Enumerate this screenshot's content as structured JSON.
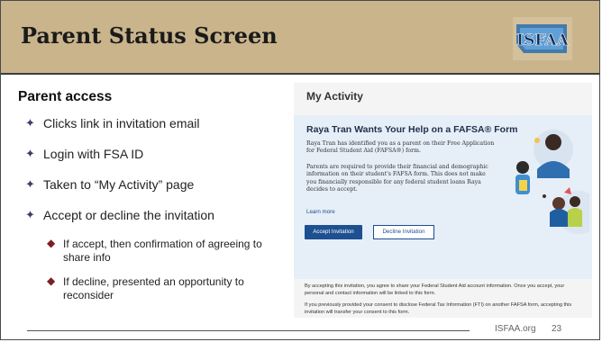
{
  "slide": {
    "title": "Parent Status Screen",
    "logo_text": "ISFAA",
    "section_heading": "Parent access",
    "bullets": [
      "Clicks link in invitation email",
      "Login with FSA ID",
      "Taken to “My Activity” page",
      "Accept or decline the invitation"
    ],
    "sub_bullets": [
      "If accept, then confirmation of agreeing to share info",
      "If decline, presented an opportunity to reconsider"
    ],
    "footer_site": "ISFAA.org",
    "page_number": "23"
  },
  "screenshot": {
    "heading": "My Activity",
    "card_title": "Raya Tran Wants Your Help on a FAFSA® Form",
    "para1": "Raya Tran has identified you as a parent on their Free Application for Federal Student Aid (FAFSA®) form.",
    "para2": "Parents are required to provide their financial and demographic information on their student's FAFSA form. This does not make you financially responsible for any federal student loans Raya decides to accept.",
    "learn_more": "Learn more",
    "accept_label": "Accept Invitation",
    "decline_label": "Decline Invitation",
    "fine1": "By accepting this invitation, you agree to share your Federal Student Aid account information. Once you accept, your personal and contact information will be linked to this form.",
    "fine2": "If you previously provided your consent to disclose Federal Tax Information (FTI) on another FAFSA form, accepting this invitation will transfer your consent to this form."
  },
  "colors": {
    "header_bg": "#c9b48c",
    "star": "#4a3766",
    "diamond": "#7b1f24",
    "button_blue": "#1d4f91",
    "card_bg": "#e6eef7"
  }
}
